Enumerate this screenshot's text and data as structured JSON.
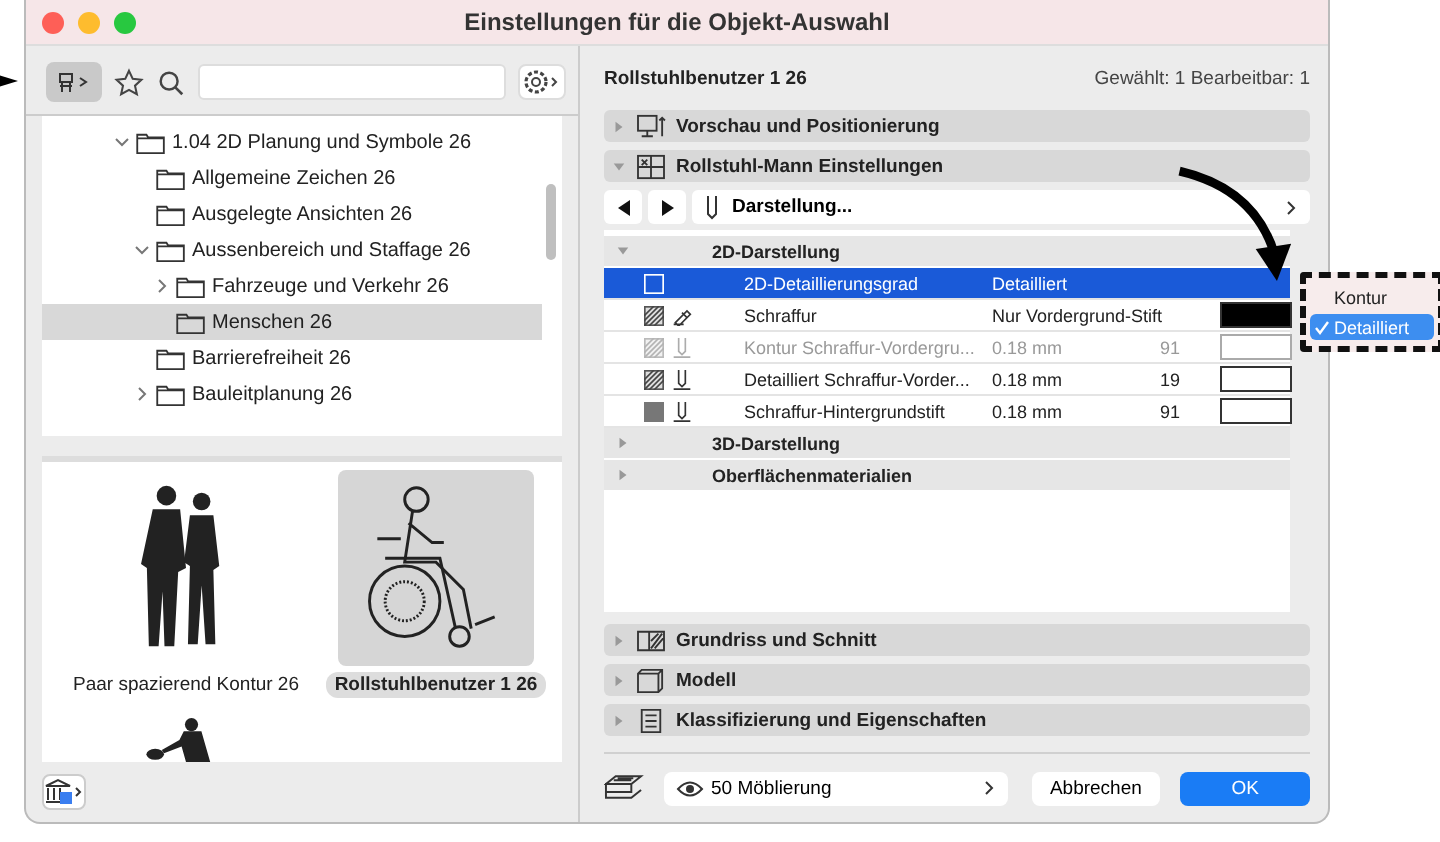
{
  "window": {
    "title": "Einstellungen für die Objekt-Auswahl"
  },
  "tree": [
    {
      "label": "1.04 2D Planung und Symbole 26",
      "expanded": true,
      "selected": false,
      "children": [
        {
          "label": "Allgemeine Zeichen 26",
          "selected": false
        },
        {
          "label": "Ausgelegte Ansichten 26",
          "selected": false
        },
        {
          "label": "Aussenbereich und Staffage 26",
          "expanded": true,
          "selected": false,
          "children": [
            {
              "label": "Fahrzeuge und Verkehr 26",
              "expanded": false,
              "selected": false
            },
            {
              "label": "Menschen 26",
              "selected": true
            }
          ]
        },
        {
          "label": "Barrierefreiheit 26",
          "selected": false
        },
        {
          "label": "Bauleitplanung 26",
          "expanded": false,
          "selected": false
        }
      ]
    }
  ],
  "gallery": [
    {
      "kind": "couple",
      "label": "Paar spazierend Kontur 26",
      "selected": false
    },
    {
      "kind": "wheelchair",
      "label": "Rollstuhlbenutzer 1 26",
      "selected": true
    },
    {
      "kind": "player",
      "selected": false
    }
  ],
  "header": {
    "object": "Rollstuhlbenutzer 1 26",
    "count": "Gewählt: 1 Bearbeitbar: 1"
  },
  "sections": [
    {
      "kind": "preview",
      "label": "Vorschau und Positionierung",
      "expanded": false
    },
    {
      "kind": "params",
      "label": "Rollstuhl-Mann Einstellungen",
      "expanded": true,
      "page": "Darstellung...",
      "groups": [
        {
          "label": "2D-Darstellung",
          "expanded": true,
          "rows": [
            {
              "kind": "choice",
              "name": "2D-Detaillierungsgrad",
              "value": "Detailliert",
              "selected": true,
              "disabled": false
            },
            {
              "kind": "fill",
              "name": "Schraffur",
              "value": "Nur Vordergrund-Stift",
              "color": "#000000",
              "selected": false,
              "disabled": false
            },
            {
              "kind": "hatch-pen",
              "name": "Kontur Schraffur-Vordergru...",
              "value": "0.18 mm",
              "pen": "91",
              "color": "#ffffff",
              "selected": false,
              "disabled": true
            },
            {
              "kind": "hatch-pen",
              "name": "Detailliert Schraffur-Vorder...",
              "value": "0.18 mm",
              "pen": "19",
              "color": "#ffffff",
              "selected": false,
              "disabled": false
            },
            {
              "kind": "solid-pen",
              "name": "Schraffur-Hintergrundstift",
              "value": "0.18 mm",
              "pen": "91",
              "color": "#ffffff",
              "selected": false,
              "disabled": false
            }
          ]
        },
        {
          "label": "3D-Darstellung",
          "expanded": false
        },
        {
          "label": "Oberflächenmaterialien",
          "expanded": false
        }
      ]
    },
    {
      "kind": "plan",
      "label": "Grundriss und Schnitt",
      "expanded": false
    },
    {
      "kind": "model",
      "label": "Modell",
      "expanded": false
    },
    {
      "kind": "classify",
      "label": "Klassifizierung und Eigenschaften",
      "expanded": false
    }
  ],
  "popup": [
    {
      "label": "Kontur",
      "checked": false
    },
    {
      "label": "Detailliert",
      "checked": true
    }
  ],
  "footer": {
    "layer": "50 Möblierung",
    "cancel": "Abbrechen",
    "ok": "OK"
  }
}
